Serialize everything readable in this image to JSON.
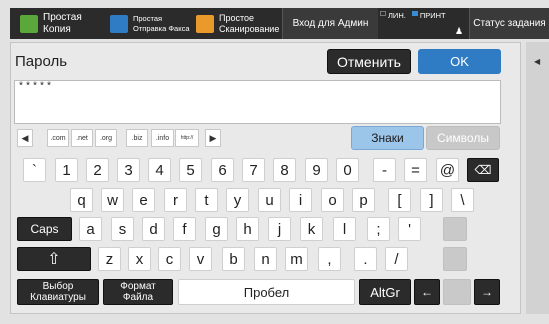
{
  "topbar": {
    "copy": [
      "Простая",
      "Копия"
    ],
    "fax": [
      "Простая",
      "Отправка Факса"
    ],
    "scan": [
      "Простое",
      "Сканирование"
    ],
    "admin": "Вход для Админ",
    "ind_line": "ЛИН.",
    "ind_print": "ПРИНТ",
    "status": "Статус задания",
    "colors": {
      "copy": "#5aa83a",
      "fax": "#2f7cc4",
      "scan": "#e99a2a",
      "print": "#3a8ad4"
    }
  },
  "dialog": {
    "title": "Пароль",
    "cancel": "Отменить",
    "ok": "OK",
    "input_value": "*****"
  },
  "domains": [
    ".com",
    ".net",
    ".org",
    ".biz",
    ".info",
    "http://"
  ],
  "mode_tabs": {
    "znaki": "Знаки",
    "simvoly": "Символы"
  },
  "keys": {
    "row1": [
      "`",
      "1",
      "2",
      "3",
      "4",
      "5",
      "6",
      "7",
      "8",
      "9",
      "0",
      "-",
      "=",
      "@"
    ],
    "row2": [
      "q",
      "w",
      "e",
      "r",
      "t",
      "y",
      "u",
      "i",
      "o",
      "p",
      "[",
      "]",
      "\\"
    ],
    "caps": "Caps",
    "row3": [
      "a",
      "s",
      "d",
      "f",
      "g",
      "h",
      "j",
      "k",
      "l",
      ";",
      "'"
    ],
    "shift": "⇧",
    "row4": [
      "z",
      "x",
      "c",
      "v",
      "b",
      "n",
      "m",
      ",",
      ".",
      "/"
    ],
    "kb_select": [
      "Выбор",
      "Клавиатуры"
    ],
    "fmt_file": [
      "Формат",
      "Файла"
    ],
    "space": "Пробел",
    "altgr": "AltGr",
    "left": "←",
    "right": "→",
    "backspace_icon": "backspace-icon"
  },
  "accent": "#2f7cc4"
}
